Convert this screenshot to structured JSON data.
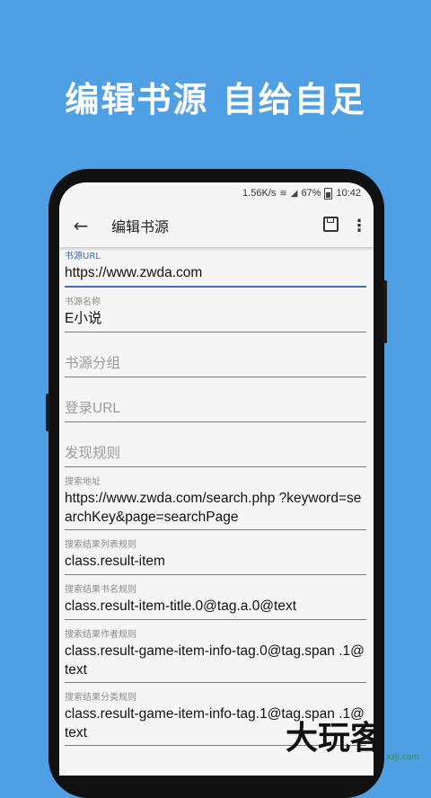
{
  "promo": {
    "title": "编辑书源  自给自足"
  },
  "status": {
    "speed": "1.56K/s",
    "battery_pct": "67%",
    "time": "10:42"
  },
  "toolbar": {
    "title": "编辑书源"
  },
  "fields": [
    {
      "label": "书源URL",
      "value": "https://www.zwda.com"
    },
    {
      "label": "书源名称",
      "value": "E小说"
    },
    {
      "label": "",
      "placeholder": "书源分组"
    },
    {
      "label": "",
      "placeholder": "登录URL"
    },
    {
      "label": "",
      "placeholder": "发现规则"
    },
    {
      "label": "搜索地址",
      "value": "https://www.zwda.com/search.php ?keyword=searchKey&page=searchPage"
    },
    {
      "label": "搜索结果列表规则",
      "value": "class.result-item"
    },
    {
      "label": "搜索结果书名规则",
      "value": "class.result-item-title.0@tag.a.0@text"
    },
    {
      "label": "搜索结果作者规则",
      "value": "class.result-game-item-info-tag.0@tag.span .1@text"
    },
    {
      "label": "搜索结果分类规则",
      "value": "class.result-game-item-info-tag.1@tag.span .1@text"
    }
  ],
  "watermark": {
    "text": "大玩客",
    "sub": "xzji.com"
  }
}
